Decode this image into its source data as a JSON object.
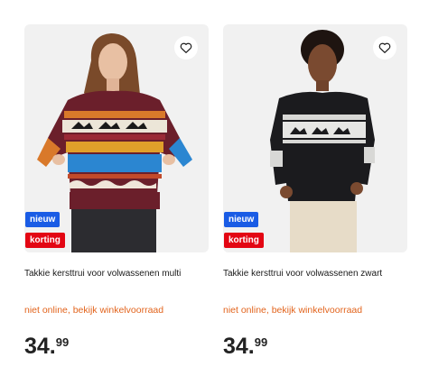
{
  "products": [
    {
      "badges": {
        "new": "nieuw",
        "discount": "korting"
      },
      "title": "Takkie kersttrui voor volwassenen multi",
      "availability": "niet online, bekijk winkelvoorraad",
      "price": {
        "whole": "34.",
        "cents": "99"
      },
      "wishlist_icon": "heart-outline-icon"
    },
    {
      "badges": {
        "new": "nieuw",
        "discount": "korting"
      },
      "title": "Takkie kersttrui voor volwassenen zwart",
      "availability": "niet online, bekijk winkelvoorraad",
      "price": {
        "whole": "34.",
        "cents": "99"
      },
      "wishlist_icon": "heart-outline-icon"
    }
  ],
  "colors": {
    "badge_new": "#1a5ce5",
    "badge_discount": "#e30613",
    "availability_text": "#e2641d",
    "image_background": "#f1f1f1"
  }
}
